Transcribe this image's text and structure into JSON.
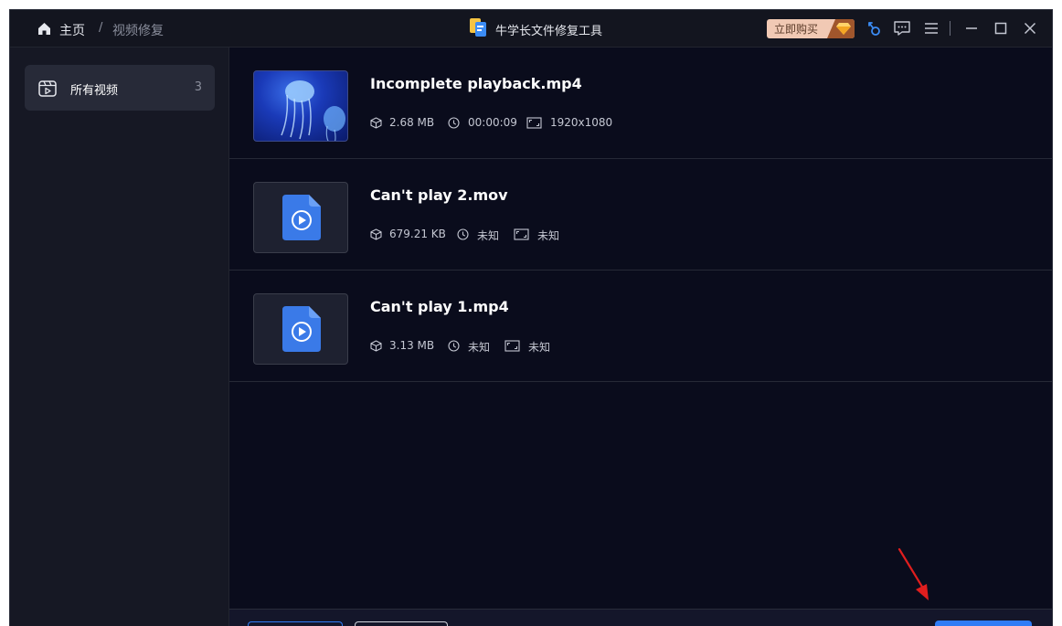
{
  "titlebar": {
    "breadcrumb_home": "主页",
    "breadcrumb_separator": "/",
    "breadcrumb_current": "视频修复",
    "app_title": "牛学长文件修复工具",
    "buy_label": "立即购买"
  },
  "sidebar": {
    "items": [
      {
        "label": "所有视频",
        "count": "3"
      }
    ]
  },
  "files": [
    {
      "name": "Incomplete playback.mp4",
      "size": "2.68 MB",
      "duration": "00:00:09",
      "resolution": "1920x1080",
      "thumbnail": "jellyfish-photo"
    },
    {
      "name": "Can't play 2.mov",
      "size": "679.21 KB",
      "duration": "未知",
      "resolution": "未知",
      "thumbnail": "video-file-icon"
    },
    {
      "name": "Can't play 1.mp4",
      "size": "3.13 MB",
      "duration": "未知",
      "resolution": "未知",
      "thumbnail": "video-file-icon"
    }
  ],
  "colors": {
    "background": "#0a0c1c",
    "sidebar": "#161824",
    "accent": "#2f7cf6",
    "buy_button": "#f1c9b4",
    "annotation_arrow": "#e01e1e"
  }
}
